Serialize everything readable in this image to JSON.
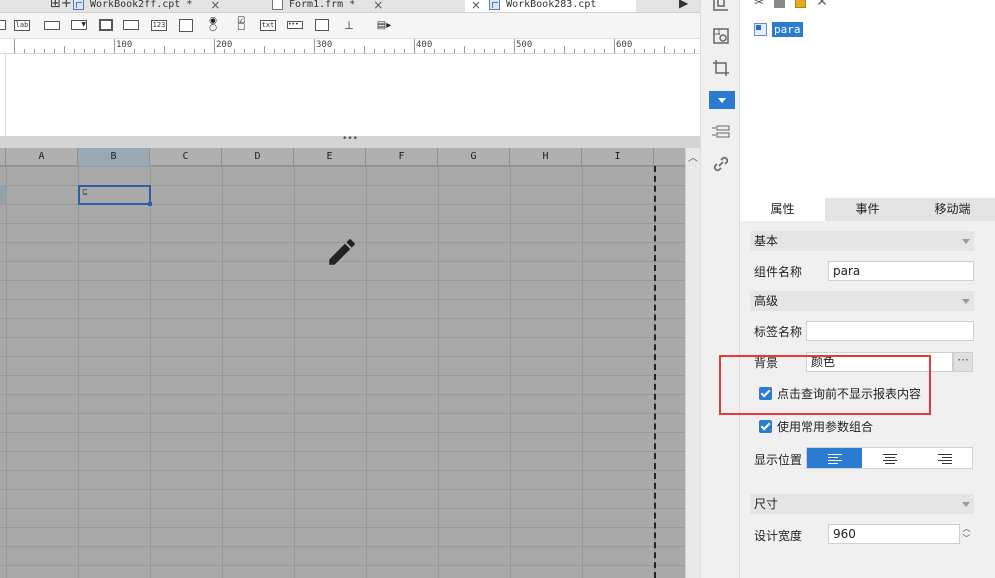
{
  "tabs": [
    {
      "label": "WorkBook2ff.cpt *",
      "type": "cpt",
      "active": false
    },
    {
      "label": "Form1.frm *",
      "type": "frm",
      "active": false
    },
    {
      "label": "WorkBook283.cpt",
      "type": "cpt",
      "active": true
    }
  ],
  "tab_close_glyph": "×",
  "tab_new_glyph": "⊞+",
  "toolbar_icons": [
    "label-widget-icon",
    "text-input-icon",
    "dropdown-icon",
    "button-widget-icon",
    "number-input-icon",
    "list-widget-icon",
    "radio-group-icon",
    "checkbox-group-icon",
    "text-widget-icon",
    "password-icon",
    "tree-widget-icon",
    "more-icon"
  ],
  "toolbar_text": {
    "lab": "lab",
    "num": "123",
    "txt": "txt"
  },
  "ruler_labels": [
    "100",
    "200",
    "300",
    "400",
    "500",
    "600"
  ],
  "splitter_glyph": "•••",
  "columns": [
    "A",
    "B",
    "C",
    "D",
    "E",
    "F",
    "G",
    "H",
    "I"
  ],
  "selected_column": "B",
  "selected_cell_marker": "⊑",
  "tree": {
    "node_label": "para"
  },
  "prop_tabs": [
    "属性",
    "事件",
    "移动端"
  ],
  "properties": {
    "basic_section": "基本",
    "widget_name_label": "组件名称",
    "widget_name_value": "para",
    "advanced_section": "高级",
    "tag_name_label": "标签名称",
    "tag_name_value": "",
    "background_label": "背景",
    "background_value": "颜色",
    "background_button": "···",
    "hide_before_query_label": "点击查询前不显示报表内容",
    "hide_before_query_checked": true,
    "use_param_combo_label": "使用常用参数组合",
    "use_param_combo_checked": true,
    "display_position_label": "显示位置",
    "align_options": [
      "left",
      "center",
      "right"
    ],
    "align_selected": "left",
    "size_section": "尺寸",
    "design_width_label": "设计宽度",
    "design_width_value": "960"
  },
  "colors": {
    "accent": "#2b7bd0",
    "highlight_box": "#e23b3b",
    "sheet_bg": "#a9a9a9"
  }
}
